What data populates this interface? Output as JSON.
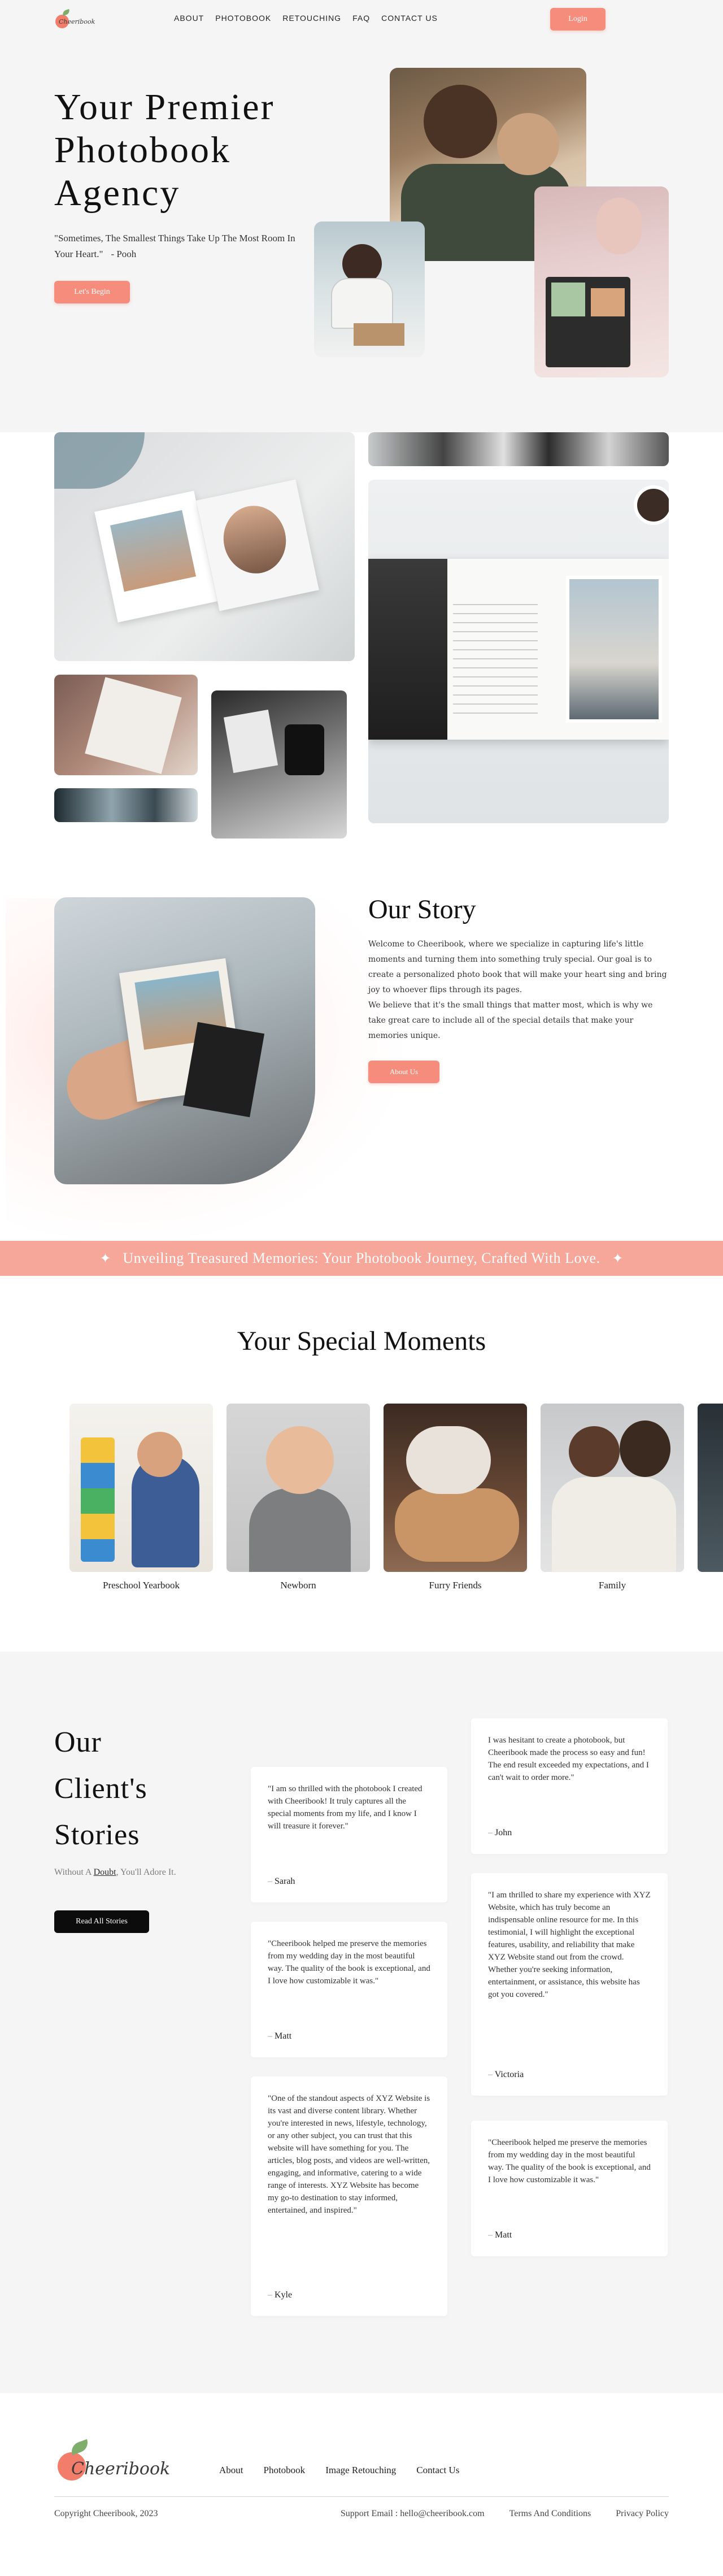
{
  "nav": {
    "logo_text": "Cheeribook",
    "links": [
      "ABOUT",
      "PHOTOBOOK",
      "RETOUCHING",
      "FAQ",
      "CONTACT US"
    ],
    "login_label": "Login"
  },
  "hero": {
    "title": "Your Premier Photobook Agency",
    "quote": "\"Sometimes, The Smallest Things Take Up The Most Room In Your Heart.\"",
    "quote_author": "- Pooh",
    "cta_label": "Let's Begin"
  },
  "story": {
    "title": "Our Story",
    "paragraph_1": "Welcome to Cheeribook, where we specialize in capturing life's little moments and turning them into something truly special. Our goal is to create a personalized photo book that will make your heart sing and bring joy to whoever flips through its pages.",
    "paragraph_2": "We believe that it's the small things that matter most, which is why we take great care to include all of the special details that make your memories unique.",
    "button_label": "About Us"
  },
  "banner": {
    "text": "Unveiling Treasured Memories: Your Photobook Journey, Crafted With Love."
  },
  "moments": {
    "title": "Your Special Moments",
    "items": [
      {
        "caption": "Preschool Yearbook"
      },
      {
        "caption": "Newborn"
      },
      {
        "caption": "Furry Friends"
      },
      {
        "caption": "Family"
      },
      {
        "caption": ""
      }
    ]
  },
  "testimonials": {
    "title": "Our Client's Stories",
    "subtitle_pre": "Without A ",
    "subtitle_link": "Doubt",
    "subtitle_post": ", You'll Adore It.",
    "button_label": "Read All Stories",
    "cards": [
      {
        "quote": "\"I am so thrilled with the photobook I created with Cheeribook! It truly captures all the special moments from my life, and I know I will treasure it forever.\"",
        "name": "Sarah"
      },
      {
        "quote": "\"Cheeribook helped me preserve the memories from my wedding day in the most beautiful way. The quality of the book is exceptional, and I love how customizable it was.\"",
        "name": "Matt"
      },
      {
        "quote": "\"One of the standout aspects of XYZ Website is its vast and diverse content library. Whether you're interested in news, lifestyle, technology, or any other subject, you can trust that this website will have something for you. The articles, blog posts, and videos are well-written, engaging, and informative, catering to a wide range of interests. XYZ Website has become my go-to destination to stay informed, entertained, and inspired.\"",
        "name": "Kyle"
      },
      {
        "quote": "I was hesitant to create a photobook, but Cheeribook made the process so easy and fun! The end result exceeded my expectations, and I can't wait to order more.\"",
        "name": "John"
      },
      {
        "quote": "\"I am thrilled to share my experience with XYZ Website, which has truly become an indispensable online resource for me. In this testimonial, I will highlight the exceptional features, usability, and reliability that make XYZ Website stand out from the crowd. Whether you're seeking information, entertainment, or assistance, this website has got you covered.\"",
        "name": "Victoria"
      },
      {
        "quote": "\"Cheeribook helped me preserve the memories from my wedding day in the most beautiful way. The quality of the book is exceptional, and I love how customizable it was.\"",
        "name": "Matt"
      }
    ]
  },
  "footer": {
    "logo_text": "Cheeribook",
    "links": [
      "About",
      "Photobook",
      "Image Retouching",
      "Contact Us"
    ],
    "copyright": "Copyright Cheeribook, 2023",
    "support": "Support Email : hello@cheeribook.com",
    "terms": "Terms And Conditions",
    "privacy": "Privacy Policy"
  },
  "colors": {
    "accent": "#f68c7b",
    "banner": "#f7a79a",
    "section_bg": "#f5f5f5",
    "dark_button": "#0c0c0c"
  }
}
